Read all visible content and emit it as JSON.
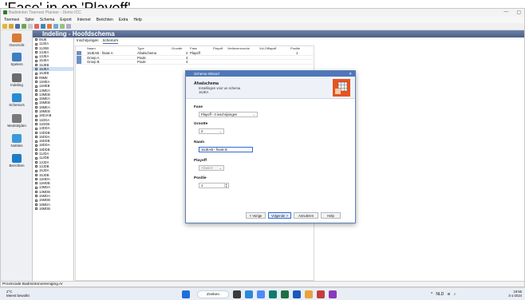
{
  "page_heading": "'Fase' in op 'Playoff'.",
  "window": {
    "title": "Badminton Toernooi Planner - Demo ICC",
    "min": "—",
    "restore": "▢",
    "close": "✕"
  },
  "menu": [
    "Toernooi",
    "Spler",
    "Schema",
    "Export",
    "Internet",
    "Berichten",
    "Extra",
    "Help"
  ],
  "section_title": "Indeling - Hoofdschema",
  "nav": [
    {
      "label": "Overzicht",
      "icon": "overview-icon",
      "color": "#d87a35"
    },
    {
      "label": "Spelers",
      "icon": "players-icon",
      "color": "#3d7fc2"
    },
    {
      "label": "Indeling",
      "icon": "draw-icon",
      "color": "#6b6b6b"
    },
    {
      "label": "Schema's",
      "icon": "schema-icon",
      "color": "#2a8bd0"
    },
    {
      "label": "Wedstrijden",
      "icon": "shuttle-icon",
      "color": "#7a7a7a"
    },
    {
      "label": "Notities",
      "icon": "notes-icon",
      "color": "#3a9ad9"
    },
    {
      "label": "Berichten",
      "icon": "messages-icon",
      "color": "#1e7bc6"
    }
  ],
  "tree": [
    "09JE",
    "11JEA",
    "11JEB",
    "13JEA",
    "13JEA",
    "15JEA",
    "15JEB",
    "16JEA",
    "16JEB",
    "09ME",
    "11MEA",
    "11MEB",
    "13MEA",
    "13MEB",
    "15MEA",
    "15MEB",
    "18MEA",
    "18MEB",
    "16DJAB",
    "11DDA",
    "11DDB",
    "13DDA",
    "13DDB",
    "15DDA",
    "15DDB",
    "18DDA",
    "18DDB",
    "11JDA",
    "11JDB",
    "13JDA",
    "13JDB",
    "15JDA",
    "15JDB",
    "11MDA",
    "11MDB",
    "13MDA",
    "13MDB",
    "15MDA",
    "15MDB",
    "18MDA",
    "18MDB"
  ],
  "tree_selected_index": 7,
  "tabs": [
    "Inschrijvingen",
    "Schema's"
  ],
  "grid": {
    "headers": [
      "Naam",
      "Type",
      "Grootte",
      "Fase",
      "Playoff",
      "Verliezersronde",
      "Vol.Offlayoff",
      "Positie"
    ],
    "rows": [
      {
        "naam": "16JEAB - finale A",
        "type": "Afvalschema",
        "grootte": "2",
        "fase": "Playoff",
        "positie": "1"
      },
      {
        "naam": "Groep A",
        "type": "Poule",
        "grootte": "4",
        "fase": "",
        "positie": ""
      },
      {
        "naam": "Groep B",
        "type": "Poule",
        "grootte": "4",
        "fase": "",
        "positie": ""
      }
    ]
  },
  "dialog": {
    "title": "Schema Wizard",
    "close": "✕",
    "heading": "Afvalschema",
    "sub1": "Instellingen voor un schema",
    "sub2": "16JEA",
    "fase_label": "Fase",
    "fase_value": "Playoff - 0 inschrijvingen",
    "grootte_label": "Grootte",
    "grootte_value": "2",
    "naam_label": "Naam",
    "naam_value": "16JEAB - finale B",
    "playoff_label": "Playoff",
    "playoff_value": "<Geen>",
    "positie_label": "Positie",
    "positie_value": "1",
    "buttons": {
      "back": "< Vorige",
      "next": "Volgende >",
      "cancel": "Annuleren",
      "help": "Help"
    }
  },
  "status_text": "Provinciale Badmintonvereniging Ar",
  "taskbar": {
    "temp": "2°C",
    "weather": "Meest bewolkt",
    "search": "Zoeken",
    "clock_time": "19:55",
    "clock_date": "3-1-2024",
    "lang": "NLD"
  }
}
